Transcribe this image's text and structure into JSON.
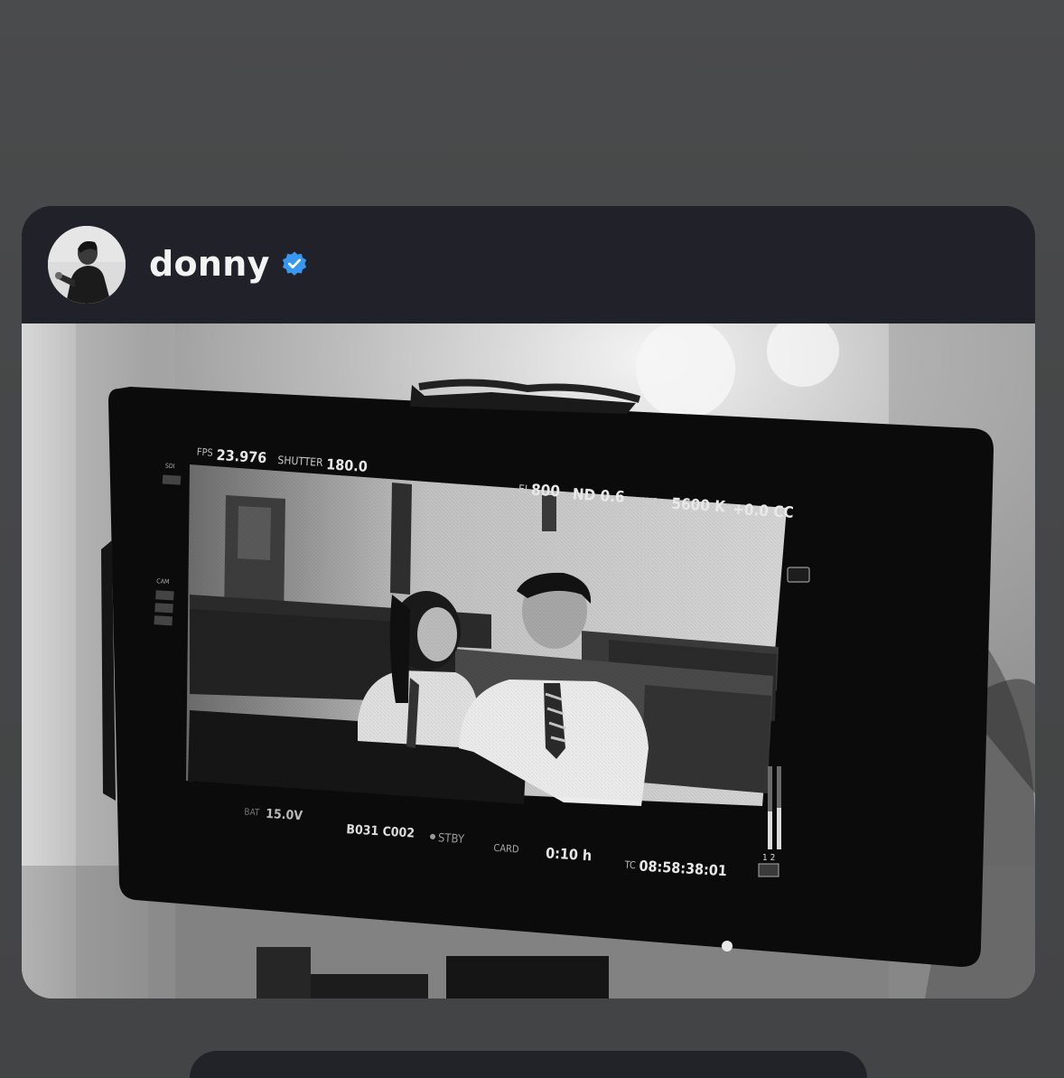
{
  "post": {
    "username": "donny",
    "verified": true,
    "avatar_icon": "profile-avatar",
    "verified_icon": "verified-badge-icon",
    "accent_color": "#3897f0"
  },
  "monitor": {
    "fps_label": "FPS",
    "fps_value": "23.976",
    "shutter_label": "SHUTTER",
    "shutter_value": "180.0",
    "ei_label": "EI",
    "ei_value": "800",
    "nd_value": "ND 0.6",
    "wb_label": "WB",
    "wb_value": "5600 K",
    "cc_value": "+0.0 CC",
    "sdi_label": "SDI",
    "cam_label": "CAM",
    "bat_label": "BAT",
    "bat_value": "15.0V",
    "clip_value": "B031 C002",
    "stby_label": "STBY",
    "card_label": "CARD",
    "card_value": "0:10 h",
    "tc_label": "TC",
    "tc_value": "08:58:38:01",
    "audio_channels": "1 2"
  }
}
